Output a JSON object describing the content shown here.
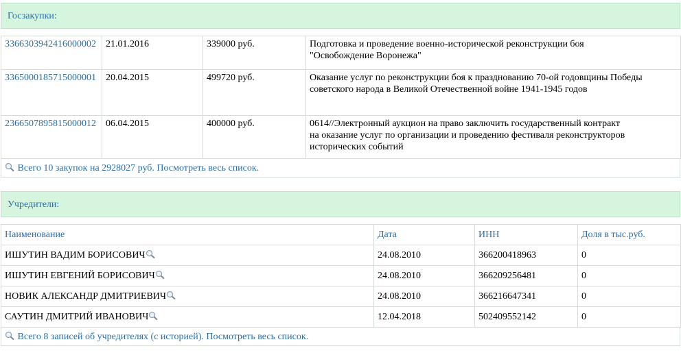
{
  "goszakupki": {
    "title": "Госзакупки:",
    "rows": [
      {
        "number": "3366303942416000002",
        "date": "21.01.2016",
        "sum": "339000 руб.",
        "desc": "Подготовка и проведение военно-исторической реконструкции боя\n\"Освобождение Воронежа\""
      },
      {
        "number": "3365000185715000001",
        "date": "20.04.2015",
        "sum": "499720 руб.",
        "desc": "Оказание услуг по реконструкции боя  к празднованию 70-ой годовщины Победы\nсоветского народа в Великой Отечественной войне 1941-1945 годов"
      },
      {
        "number": "2366507895815000012",
        "date": "06.04.2015",
        "sum": "400000 руб.",
        "desc": "0614//Электронный аукцион на право заключить государственный контракт\nна оказание услуг по организации и проведению фестиваля реконструкторов исторических событий"
      }
    ],
    "summary": "Всего 10 закупок на 2928027 руб. Посмотреть весь список."
  },
  "founders": {
    "title": "Учредители:",
    "headers": {
      "name": "Наименование",
      "date": "Дата",
      "inn": "ИНН",
      "share": "Доля в тыс.руб."
    },
    "rows": [
      {
        "name": "ИШУТИН ВАДИМ БОРИСОВИЧ",
        "date": "24.08.2010",
        "inn": "366200418963",
        "share": "0"
      },
      {
        "name": "ИШУТИН ЕВГЕНИЙ БОРИСОВИЧ",
        "date": "24.08.2010",
        "inn": "366209256481",
        "share": "0"
      },
      {
        "name": "НОВИК АЛЕКСАНДР ДМИТРИЕВИЧ",
        "date": "24.08.2010",
        "inn": "366216647341",
        "share": "0"
      },
      {
        "name": "САУТИН ДМИТРИЙ ИВАНОВИЧ",
        "date": "12.04.2018",
        "inn": "502409552142",
        "share": "0"
      }
    ],
    "summary": "Всего 8 записей об учредителях (с историей). Посмотреть весь список."
  },
  "icons": {
    "magnifier": "magnifier-icon"
  },
  "colors": {
    "link": "#2b6ea6",
    "header_bg": "#d6f5df"
  }
}
